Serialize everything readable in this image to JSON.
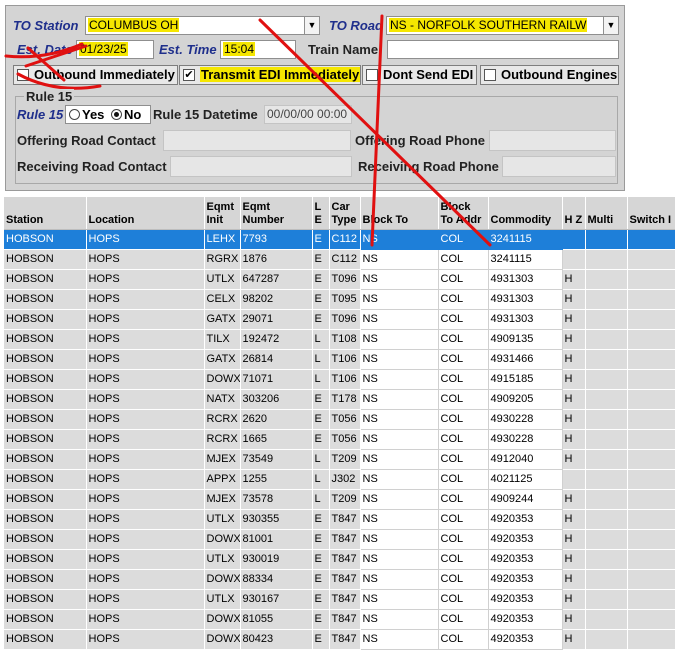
{
  "form": {
    "to_station_label": "TO Station",
    "to_station_value": "COLUMBUS OH",
    "to_road_label": "TO Road",
    "to_road_value": "NS - NORFOLK SOUTHERN RAILW",
    "est_date_label": "Est. Date",
    "est_date_value": "01/23/25",
    "est_time_label": "Est. Time",
    "est_time_value": "15:04",
    "train_name_label": "Train Name",
    "train_name_value": "",
    "outbound_immediately": "Outbound Immediately",
    "transmit_edi": "Transmit EDI Immediately",
    "transmit_edi_checked": "✔",
    "dont_send_edi": "Dont Send EDI",
    "outbound_engines": "Outbound Engines",
    "rule15_title": "Rule 15",
    "rule15_label": "Rule 15",
    "rule15_yes": "Yes",
    "rule15_no": "No",
    "rule15_selected": "No",
    "rule15_datetime_label": "Rule 15 Datetime",
    "rule15_datetime_value": "00/00/00 00:00",
    "offering_contact_label": "Offering Road Contact",
    "offering_phone_label": "Offering Road Phone",
    "receiving_contact_label": "Receiving Road Contact",
    "receiving_phone_label": "Receiving Road Phone"
  },
  "table": {
    "headers": [
      "Station",
      "Location",
      "Eqmt Init",
      "Eqmt Number",
      "L E",
      "Car Type",
      "Block To",
      "Block To Addr",
      "Commodity",
      "H Z",
      "Multi",
      "Switch I"
    ],
    "rows": [
      [
        "HOBSON",
        "HOPS",
        "LEHX",
        "7793",
        "E",
        "C112",
        "NS",
        "COL",
        "3241115",
        "",
        "",
        ""
      ],
      [
        "HOBSON",
        "HOPS",
        "RGRX",
        "1876",
        "E",
        "C112",
        "NS",
        "COL",
        "3241115",
        "",
        "",
        ""
      ],
      [
        "HOBSON",
        "HOPS",
        "UTLX",
        "647287",
        "E",
        "T096",
        "NS",
        "COL",
        "4931303",
        "H",
        "",
        ""
      ],
      [
        "HOBSON",
        "HOPS",
        "CELX",
        "98202",
        "E",
        "T095",
        "NS",
        "COL",
        "4931303",
        "H",
        "",
        ""
      ],
      [
        "HOBSON",
        "HOPS",
        "GATX",
        "29071",
        "E",
        "T096",
        "NS",
        "COL",
        "4931303",
        "H",
        "",
        ""
      ],
      [
        "HOBSON",
        "HOPS",
        "TILX",
        "192472",
        "L",
        "T108",
        "NS",
        "COL",
        "4909135",
        "H",
        "",
        ""
      ],
      [
        "HOBSON",
        "HOPS",
        "GATX",
        "26814",
        "L",
        "T106",
        "NS",
        "COL",
        "4931466",
        "H",
        "",
        ""
      ],
      [
        "HOBSON",
        "HOPS",
        "DOWX",
        "71071",
        "L",
        "T106",
        "NS",
        "COL",
        "4915185",
        "H",
        "",
        ""
      ],
      [
        "HOBSON",
        "HOPS",
        "NATX",
        "303206",
        "E",
        "T178",
        "NS",
        "COL",
        "4909205",
        "H",
        "",
        ""
      ],
      [
        "HOBSON",
        "HOPS",
        "RCRX",
        "2620",
        "E",
        "T056",
        "NS",
        "COL",
        "4930228",
        "H",
        "",
        ""
      ],
      [
        "HOBSON",
        "HOPS",
        "RCRX",
        "1665",
        "E",
        "T056",
        "NS",
        "COL",
        "4930228",
        "H",
        "",
        ""
      ],
      [
        "HOBSON",
        "HOPS",
        "MJEX",
        "73549",
        "L",
        "T209",
        "NS",
        "COL",
        "4912040",
        "H",
        "",
        ""
      ],
      [
        "HOBSON",
        "HOPS",
        "APPX",
        "1255",
        "L",
        "J302",
        "NS",
        "COL",
        "4021125",
        "",
        "",
        ""
      ],
      [
        "HOBSON",
        "HOPS",
        "MJEX",
        "73578",
        "L",
        "T209",
        "NS",
        "COL",
        "4909244",
        "H",
        "",
        ""
      ],
      [
        "HOBSON",
        "HOPS",
        "UTLX",
        "930355",
        "E",
        "T847",
        "NS",
        "COL",
        "4920353",
        "H",
        "",
        ""
      ],
      [
        "HOBSON",
        "HOPS",
        "DOWX",
        "81001",
        "E",
        "T847",
        "NS",
        "COL",
        "4920353",
        "H",
        "",
        ""
      ],
      [
        "HOBSON",
        "HOPS",
        "UTLX",
        "930019",
        "E",
        "T847",
        "NS",
        "COL",
        "4920353",
        "H",
        "",
        ""
      ],
      [
        "HOBSON",
        "HOPS",
        "DOWX",
        "88334",
        "E",
        "T847",
        "NS",
        "COL",
        "4920353",
        "H",
        "",
        ""
      ],
      [
        "HOBSON",
        "HOPS",
        "UTLX",
        "930167",
        "E",
        "T847",
        "NS",
        "COL",
        "4920353",
        "H",
        "",
        ""
      ],
      [
        "HOBSON",
        "HOPS",
        "DOWX",
        "81055",
        "E",
        "T847",
        "NS",
        "COL",
        "4920353",
        "H",
        "",
        ""
      ],
      [
        "HOBSON",
        "HOPS",
        "DOWX",
        "80423",
        "E",
        "T847",
        "NS",
        "COL",
        "4920353",
        "H",
        "",
        ""
      ]
    ]
  },
  "colors": {
    "selection": "#1e7fd9",
    "highlight": "#f5e600",
    "annotation_ink": "#e01010",
    "label_blue": "#1f2f8c"
  }
}
